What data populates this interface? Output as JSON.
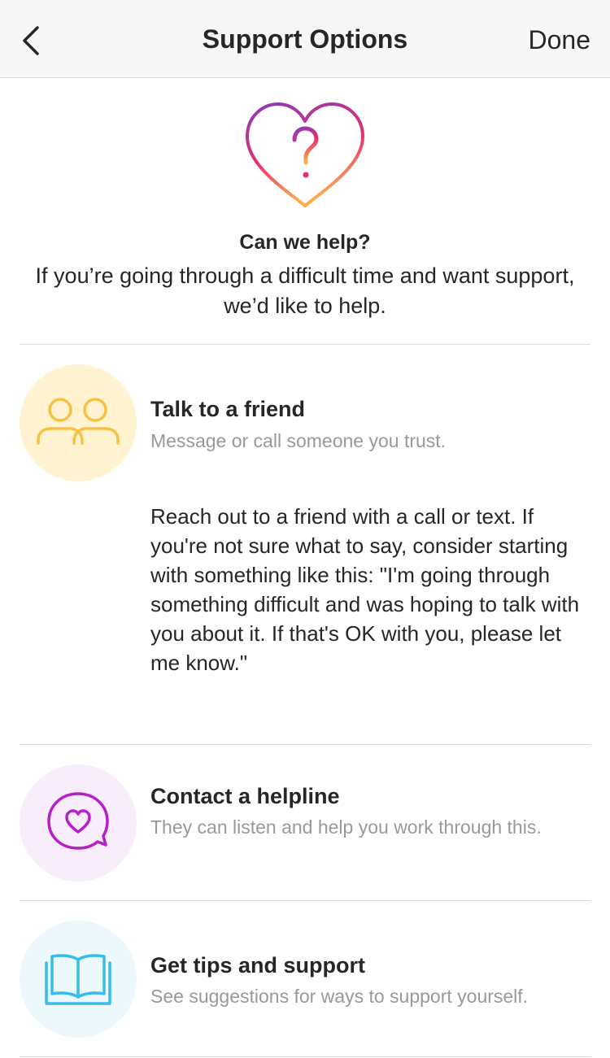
{
  "nav": {
    "title": "Support Options",
    "done_label": "Done",
    "back_icon": "chevron-left-icon"
  },
  "hero": {
    "icon": "heart-question-icon",
    "title": "Can we help?",
    "description": "If you’re going through a difficult time and want support, we’d like to help."
  },
  "options": [
    {
      "icon": "two-people-icon",
      "title": "Talk to a friend",
      "subtitle": "Message or call someone you trust.",
      "body": "Reach out to a friend with a call or text. If you're not sure what to say, consider starting with something like this: \"I'm going through something difficult and was hoping to talk with you about it. If that's OK with you, please let me know.\""
    },
    {
      "icon": "heart-chat-bubble-icon",
      "title": "Contact a helpline",
      "subtitle": "They can listen and help you work through this."
    },
    {
      "icon": "open-book-icon",
      "title": "Get tips and support",
      "subtitle": "See suggestions for ways to support yourself."
    }
  ],
  "colors": {
    "friend_circle": "#fff3d1",
    "friend_icon": "#f7c244",
    "helpline_circle": "#f8eefb",
    "helpline_icon": "#b71fcb",
    "tips_circle": "#edf8fd",
    "tips_icon": "#37bde8",
    "heart_gradient_top": "#8a3ab9",
    "heart_gradient_mid": "#e1306c",
    "heart_gradient_bottom": "#fbad50"
  }
}
